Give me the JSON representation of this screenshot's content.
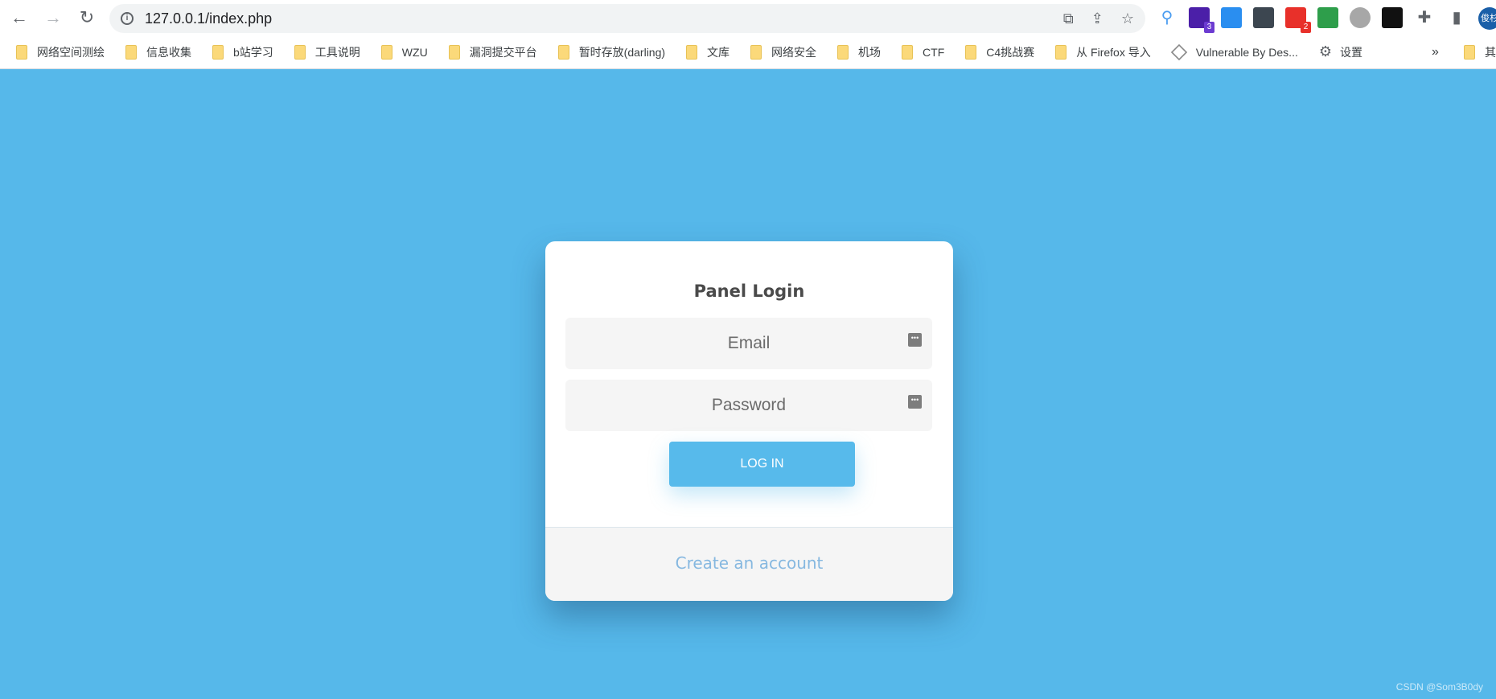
{
  "browser": {
    "url": "127.0.0.1/index.php",
    "nav": {
      "back": "←",
      "forward": "→",
      "reload": "↻"
    },
    "omnibox_icons": [
      "translate-icon",
      "share-icon",
      "star-icon"
    ],
    "extensions": [
      {
        "name": "pin-icon",
        "color": "#4a9cf0",
        "badge": ""
      },
      {
        "name": "gem-extension-icon",
        "color": "#4b1fa8",
        "badge": "3",
        "badge_color": "#6c3bd1"
      },
      {
        "name": "bird-extension-icon",
        "color": "#2a8ef0",
        "badge": ""
      },
      {
        "name": "password-extension-icon",
        "color": "#3c4650",
        "badge": ""
      },
      {
        "name": "red-extension-icon",
        "color": "#e8302a",
        "badge": "2",
        "badge_color": "#e8302a"
      },
      {
        "name": "globe-extension-icon",
        "color": "#2e9e4b",
        "badge": ""
      },
      {
        "name": "circle-extension-icon",
        "color": "#a7a7a7",
        "badge": ""
      },
      {
        "name": "h-extension-icon",
        "color": "#111111",
        "badge": ""
      },
      {
        "name": "puzzle-icon",
        "color": "#5f6368",
        "badge": ""
      },
      {
        "name": "sidepanel-icon",
        "color": "#5f6368",
        "badge": ""
      }
    ],
    "profile_label": "俊杉",
    "bookmarks": [
      "网络空间测绘",
      "信息收集",
      "b站学习",
      "工具说明",
      "WZU",
      "漏洞提交平台",
      "暂时存放(darling)",
      "文库",
      "网络安全",
      "机场",
      "CTF",
      "C4挑战赛",
      "从 Firefox 导入",
      "Vulnerable By Des...",
      "设置"
    ],
    "bookmarks_overflow": "»",
    "bookmarks_other": "其"
  },
  "login": {
    "title": "Panel Login",
    "email_placeholder": "Email",
    "password_placeholder": "Password",
    "submit": "LOG IN",
    "create_account": "Create an account"
  },
  "watermark": "CSDN @Som3B0dy",
  "colors": {
    "background": "#56b8ea",
    "button": "#57baeb",
    "link": "#86b8e0"
  }
}
